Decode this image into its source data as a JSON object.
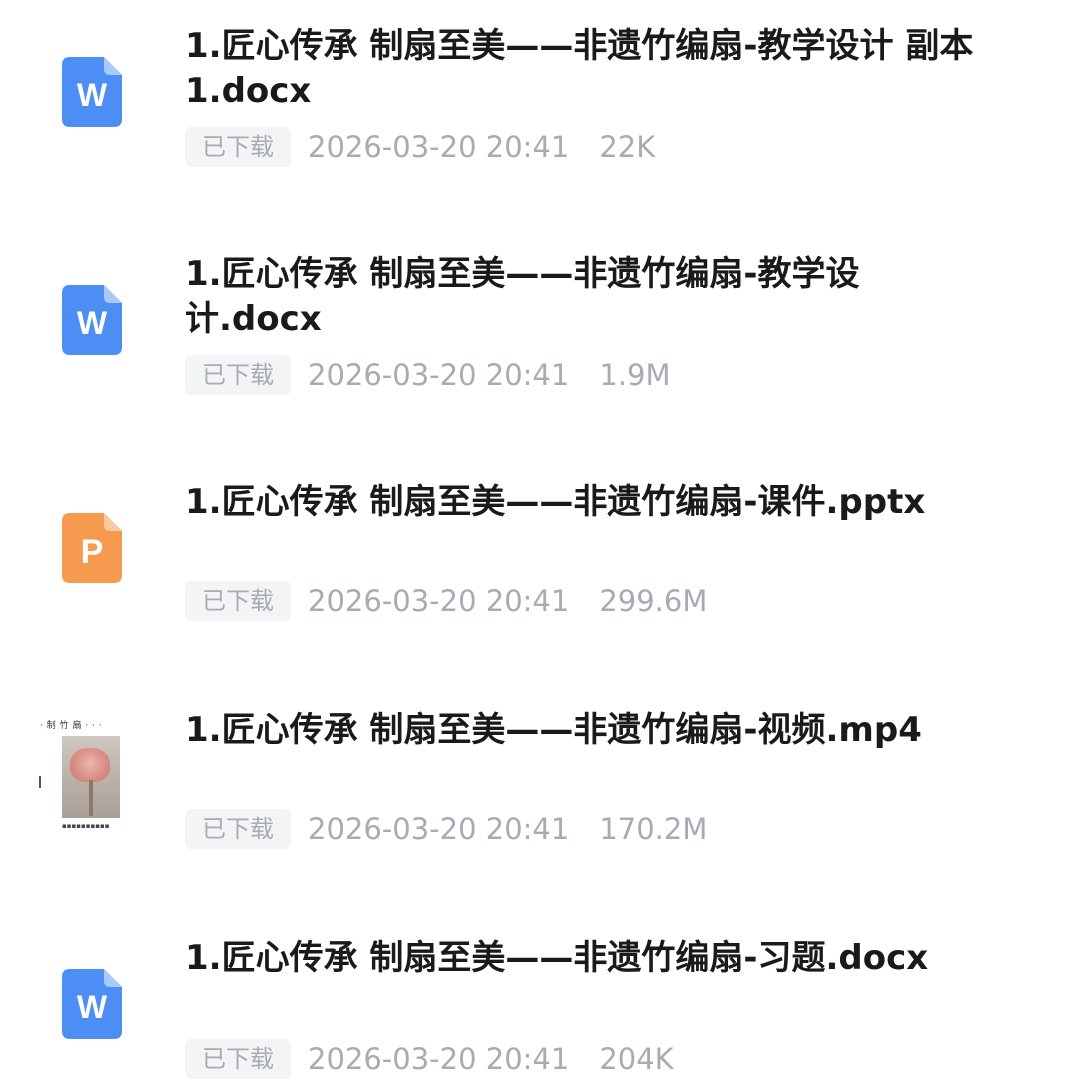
{
  "files": [
    {
      "name": "1.匠心传承 制扇至美——非遗竹编扇-教学设计 副本1.docx",
      "icon": "word-doc-icon",
      "icon_letter": "W",
      "status": "已下载",
      "date": "2026-03-20 20:41",
      "size": "22K"
    },
    {
      "name": "1.匠心传承 制扇至美——非遗竹编扇-教学设计.docx",
      "icon": "word-doc-icon",
      "icon_letter": "W",
      "status": "已下载",
      "date": "2026-03-20 20:41",
      "size": "1.9M"
    },
    {
      "name": "1.匠心传承 制扇至美——非遗竹编扇-课件.pptx",
      "icon": "powerpoint-icon",
      "icon_letter": "P",
      "status": "已下载",
      "date": "2026-03-20 20:41",
      "size": "299.6M"
    },
    {
      "name": "1.匠心传承 制扇至美——非遗竹编扇-视频.mp4",
      "icon": "video-thumbnail",
      "status": "已下载",
      "date": "2026-03-20 20:41",
      "size": "170.2M"
    },
    {
      "name": "1.匠心传承 制扇至美——非遗竹编扇-习题.docx",
      "icon": "word-doc-icon",
      "icon_letter": "W",
      "status": "已下载",
      "date": "2026-03-20 20:41",
      "size": "204K"
    }
  ],
  "colors": {
    "word_icon": "#4d8ef5",
    "ppt_icon": "#f59a4f",
    "meta_text": "#a7abb3",
    "badge_bg": "#f3f4f6",
    "title_text": "#1a1a1a"
  }
}
